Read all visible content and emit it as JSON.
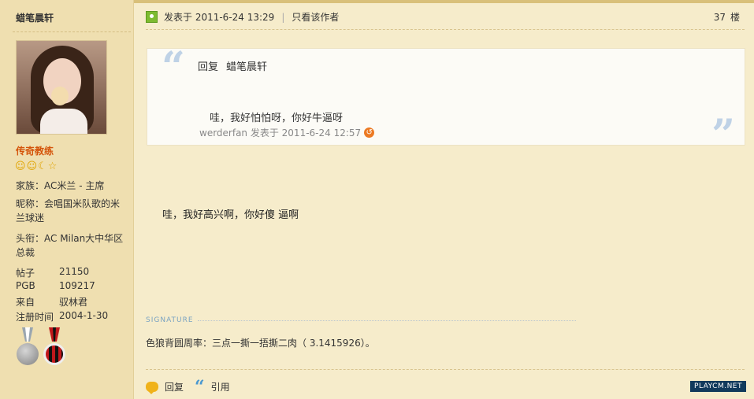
{
  "author": {
    "name": "蜡笔晨轩",
    "rank": "传奇教练",
    "level_icons": [
      "smiley-icon",
      "smiley-icon",
      "moon-icon",
      "star-icon"
    ],
    "family": "家族：AC米兰 - 主席",
    "nickname": "昵称：会唱国米队歌的米兰球迷",
    "title": "头衔：AC Milan大中华区总裁",
    "stats": [
      {
        "label": "帖子",
        "value": "21150"
      },
      {
        "label": "PGB",
        "value": "109217"
      },
      {
        "label": "来自",
        "value": "驭林君"
      },
      {
        "label": "注册时间",
        "value": "2004-1-30"
      }
    ],
    "medals": [
      "vip-medal-icon",
      "ac-milan-medal-icon"
    ]
  },
  "post": {
    "posted_at": "发表于 2011-6-24 13:29",
    "only_author": "只看该作者",
    "floor_number": "37",
    "floor_label": "楼",
    "quote": {
      "reply_prefix": "回复",
      "reply_to": "蜡笔晨轩",
      "text": "哇，我好怕怕呀，你好牛逼呀",
      "meta": "werderfan 发表于 2011-6-24 12:57"
    },
    "body": "哇，我好高兴啊，你好傻 逼啊",
    "signature_label": "SIGNATURE",
    "signature": "色狼背圆周率：三点一撕一捂撕二肉（ 3.1415926）。",
    "actions": {
      "reply": "回复",
      "quote": "引用"
    }
  },
  "watermark": "PLAYCM.NET",
  "colors": {
    "accent": "#d4540a",
    "sidebar": "#efdfb0",
    "page": "#f6eccb",
    "quote_mark": "#bfd2e6"
  }
}
